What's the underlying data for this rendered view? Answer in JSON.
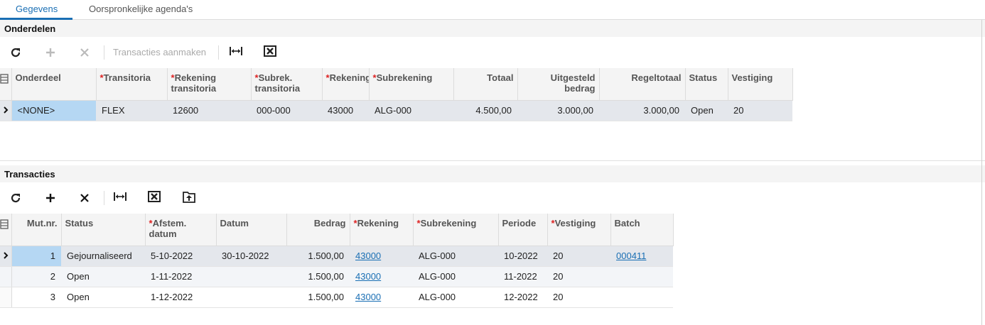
{
  "tabs": [
    {
      "label": "Gegevens"
    },
    {
      "label": "Oorspronkelijke agenda's"
    }
  ],
  "onderdelen": {
    "title": "Onderdelen",
    "toolbar": {
      "create_transactions_label": "Transacties aanmaken"
    },
    "columns": [
      {
        "label": "Onderdeel",
        "required": false
      },
      {
        "label": "Transitoria",
        "required": true
      },
      {
        "label": "Rekening transitoria",
        "required": true
      },
      {
        "label": "Subrek. transitoria",
        "required": true
      },
      {
        "label": "Rekening",
        "required": true
      },
      {
        "label": "Subrekening",
        "required": true
      },
      {
        "label": "Totaal",
        "required": false
      },
      {
        "label": "Uitgesteld bedrag",
        "required": false
      },
      {
        "label": "Regeltotaal",
        "required": false
      },
      {
        "label": "Status",
        "required": false
      },
      {
        "label": "Vestiging",
        "required": false
      }
    ],
    "rows": [
      [
        "<NONE>",
        "FLEX",
        "12600",
        "000-000",
        "43000",
        "ALG-000",
        "4.500,00",
        "3.000,00",
        "3.000,00",
        "Open",
        "20"
      ]
    ]
  },
  "transacties": {
    "title": "Transacties",
    "columns": [
      {
        "label": "Mut.nr.",
        "required": false
      },
      {
        "label": "Status",
        "required": false
      },
      {
        "label": "Afstem. datum",
        "required": true
      },
      {
        "label": "Datum",
        "required": false
      },
      {
        "label": "Bedrag",
        "required": false
      },
      {
        "label": "Rekening",
        "required": true
      },
      {
        "label": "Subrekening",
        "required": true
      },
      {
        "label": "Periode",
        "required": false
      },
      {
        "label": "Vestiging",
        "required": true
      },
      {
        "label": "Batch",
        "required": false
      }
    ],
    "rows": [
      [
        "1",
        "Gejournaliseerd",
        "5-10-2022",
        "30-10-2022",
        "1.500,00",
        "43000",
        "ALG-000",
        "10-2022",
        "20",
        "000411"
      ],
      [
        "2",
        "Open",
        "1-11-2022",
        "",
        "1.500,00",
        "43000",
        "ALG-000",
        "11-2022",
        "20",
        ""
      ],
      [
        "3",
        "Open",
        "1-12-2022",
        "",
        "1.500,00",
        "43000",
        "ALG-000",
        "12-2022",
        "20",
        ""
      ]
    ]
  }
}
